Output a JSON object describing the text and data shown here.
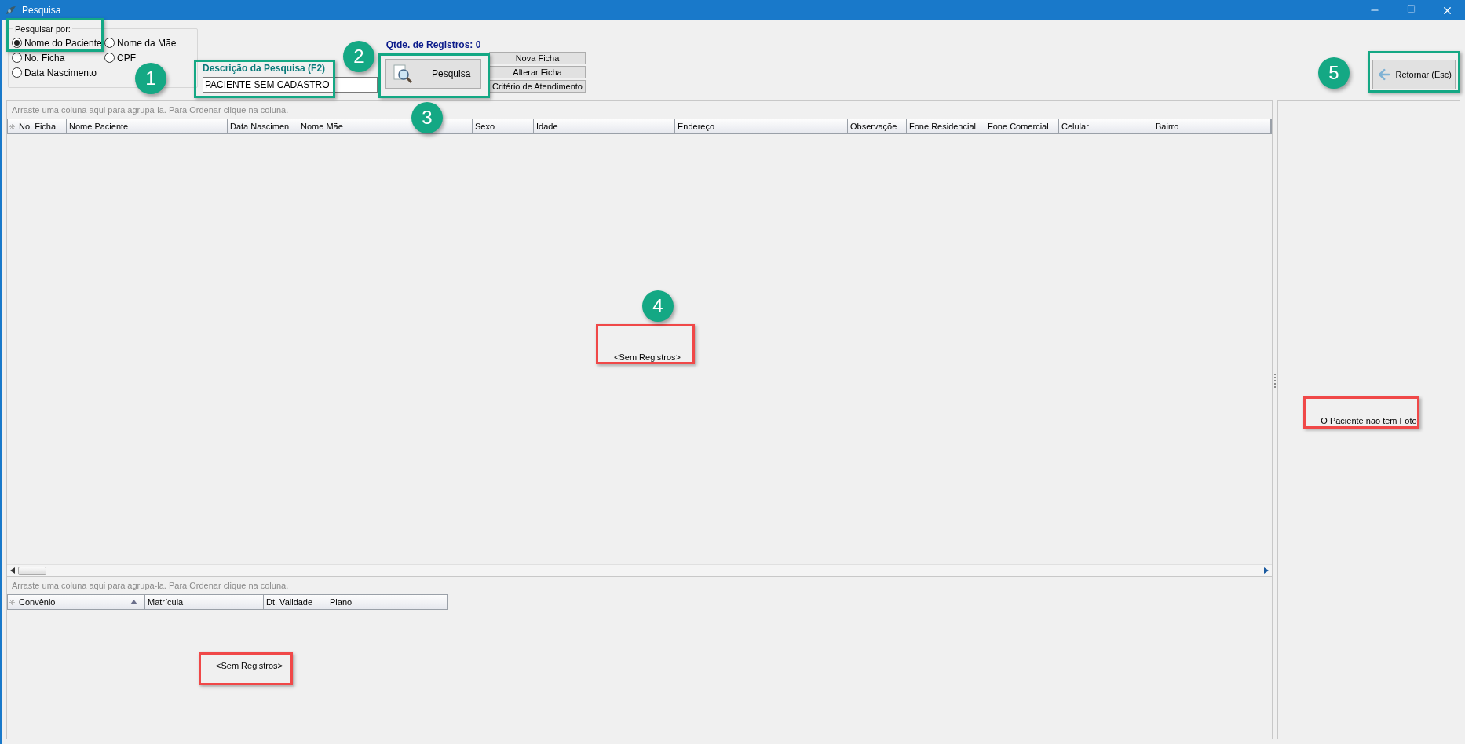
{
  "window": {
    "title": "Pesquisa"
  },
  "search_by": {
    "legend": "Pesquisar por:",
    "options": [
      {
        "label": "Nome do Paciente",
        "selected": true
      },
      {
        "label": "Nome da Mãe",
        "selected": false
      },
      {
        "label": "No. Ficha",
        "selected": false
      },
      {
        "label": "CPF",
        "selected": false
      },
      {
        "label": "Data Nascimento",
        "selected": false
      }
    ]
  },
  "search": {
    "label": "Descrição da Pesquisa (F2)",
    "value": "PACIENTE SEM CADASTRO",
    "button": "Pesquisa"
  },
  "record_count": "Qtde. de Registros: 0",
  "actions": [
    "Nova Ficha",
    "Alterar Ficha",
    "Critério de Atendimento"
  ],
  "return_button": "Retornar (Esc)",
  "patients_grid": {
    "group_hint": "Arraste uma coluna aqui para agrupa-la. Para Ordenar clique na coluna.",
    "columns": [
      {
        "label": "No. Ficha"
      },
      {
        "label": "Nome Paciente"
      },
      {
        "label": "Data Nascimen"
      },
      {
        "label": "Nome Mãe"
      },
      {
        "label": "Sexo"
      },
      {
        "label": "Idade"
      },
      {
        "label": "Endereço"
      },
      {
        "label": "Observaçõe"
      },
      {
        "label": "Fone Residencial"
      },
      {
        "label": "Fone Comercial"
      },
      {
        "label": "Celular"
      },
      {
        "label": "Bairro"
      }
    ],
    "empty": "<Sem Registros>"
  },
  "plans_grid": {
    "group_hint": "Arraste uma coluna aqui para agrupa-la. Para Ordenar clique na coluna.",
    "columns": [
      {
        "label": "Convênio",
        "sorted": true
      },
      {
        "label": "Matrícula",
        "sorted": false
      },
      {
        "label": "Dt. Validade",
        "sorted": false
      },
      {
        "label": "Plano",
        "sorted": false
      }
    ],
    "empty": "<Sem Registros>"
  },
  "photo_panel": {
    "text": "O Paciente não tem Foto"
  },
  "highlights": [
    {
      "color": "#14a884"
    },
    {
      "color": "#14a884"
    },
    {
      "color": "#14a884"
    },
    {
      "color": "#14a884"
    },
    {
      "color": "#f04848"
    },
    {
      "color": "#f04848"
    },
    {
      "color": "#f04848"
    }
  ],
  "callouts": [
    {
      "number": "1"
    },
    {
      "number": "2"
    },
    {
      "number": "3"
    },
    {
      "number": "4"
    },
    {
      "number": "5"
    }
  ]
}
